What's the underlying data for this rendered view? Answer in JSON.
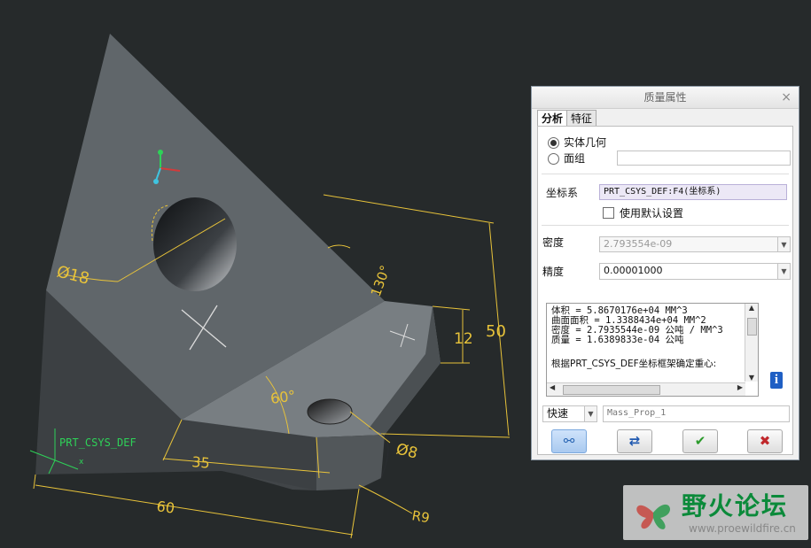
{
  "viewport": {
    "dimensions": {
      "diameter_hole": "Ø18",
      "angle_top": "130°",
      "height_total": "50",
      "height_base": "12",
      "angle_mid": "60°",
      "length_35": "35",
      "length_60": "60",
      "diameter_small": "Ø8",
      "radius": "R9"
    },
    "csys_label": "PRT_CSYS_DEF",
    "axis_x": "x"
  },
  "dialog": {
    "title": "质量属性",
    "tabs": [
      {
        "label": "分析"
      },
      {
        "label": "特征"
      }
    ],
    "radio_solid": "实体几何",
    "radio_quilt": "面组",
    "csys_label": "坐标系",
    "csys_value": "PRT_CSYS_DEF:F4(坐标系)",
    "use_default_label": "使用默认设置",
    "density_label": "密度",
    "density_value": "2.793554e-09",
    "accuracy_label": "精度",
    "accuracy_value": "0.00001000",
    "results": [
      "体积 =  5.8670176e+04  MM^3",
      "曲面面积 =  1.3388434e+04  MM^2",
      "密度 =  2.7935544e-09 公吨 / MM^3",
      "质量 =  1.6389833e-04 公吨",
      "",
      "根据PRT_CSYS_DEF坐标框架确定重心:"
    ],
    "quick_value": "快速",
    "name_value": "Mass_Prop_1"
  },
  "watermark": {
    "title": "野火论坛",
    "url": "www.proewildfire.cn"
  },
  "colors": {
    "background": "#262a2b",
    "dimension": "#e8c33a",
    "part": "#5f6467"
  }
}
